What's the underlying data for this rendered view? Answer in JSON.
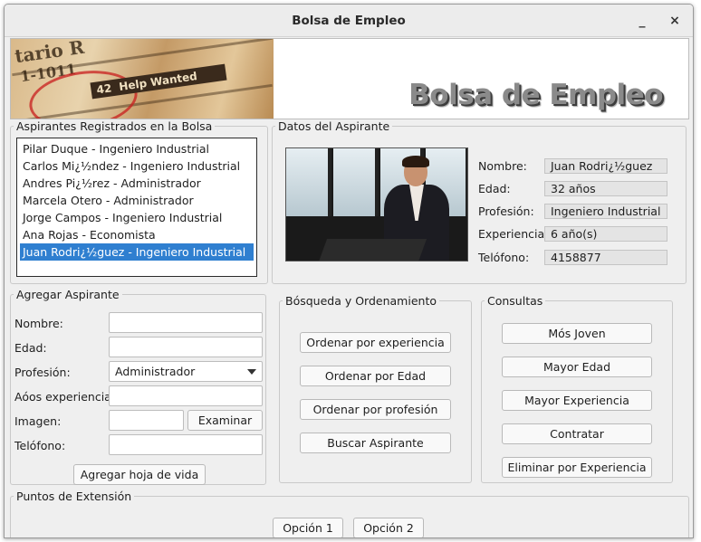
{
  "window": {
    "title": "Bolsa de Empleo",
    "minimize_glyph": "_",
    "close_glyph": "×"
  },
  "banner": {
    "title": "Bolsa de Empleo",
    "newspaper_text": [
      "tario R",
      "1-1011",
      "42",
      "Help Wanted"
    ]
  },
  "registrados": {
    "legend": "Aspirantes Registrados en la Bolsa",
    "items": [
      "Pilar Duque - Ingeniero Industrial",
      "Carlos Mi¿½ndez - Ingeniero Industrial",
      "Andres Pi¿½rez - Administrador",
      "Marcela Otero - Administrador",
      "Jorge Campos - Ingeniero Industrial",
      "Ana Rojas - Economista",
      "Juan Rodri¿½guez - Ingeniero Industrial"
    ],
    "selected_index": 6
  },
  "datos": {
    "legend": "Datos del Aspirante",
    "labels": {
      "nombre": "Nombre:",
      "edad": "Edad:",
      "profesion": "Profesión:",
      "experiencia": "Experiencia:",
      "telefono": "Telófono:"
    },
    "values": {
      "nombre": "Juan Rodri¿½guez",
      "edad": "32 años",
      "profesion": "Ingeniero Industrial",
      "experiencia": "6 año(s)",
      "telefono": "4158877"
    }
  },
  "agregar": {
    "legend": "Agregar Aspirante",
    "labels": {
      "nombre": "Nombre:",
      "edad": "Edad:",
      "profesion": "Profesión:",
      "experiencia": "Aóos experiencia:",
      "imagen": "Imagen:",
      "telefono": "Telófono:"
    },
    "profesion_selected": "Administrador",
    "examinar_label": "Examinar",
    "submit_label": "Agregar hoja de vida"
  },
  "busqueda": {
    "legend": "Bósqueda y Ordenamiento",
    "buttons": [
      "Ordenar por experiencia",
      "Ordenar por Edad",
      "Ordenar por profesión",
      "Buscar Aspirante"
    ]
  },
  "consultas": {
    "legend": "Consultas",
    "buttons": [
      "Mós Joven",
      "Mayor Edad",
      "Mayor Experiencia",
      "Contratar",
      "Eliminar por Experiencia"
    ]
  },
  "extension": {
    "legend": "Puntos de Extensión",
    "buttons": [
      "Opción 1",
      "Opción 2"
    ]
  },
  "colors": {
    "selection": "#2f7fd0",
    "window_bg": "#efefef"
  }
}
